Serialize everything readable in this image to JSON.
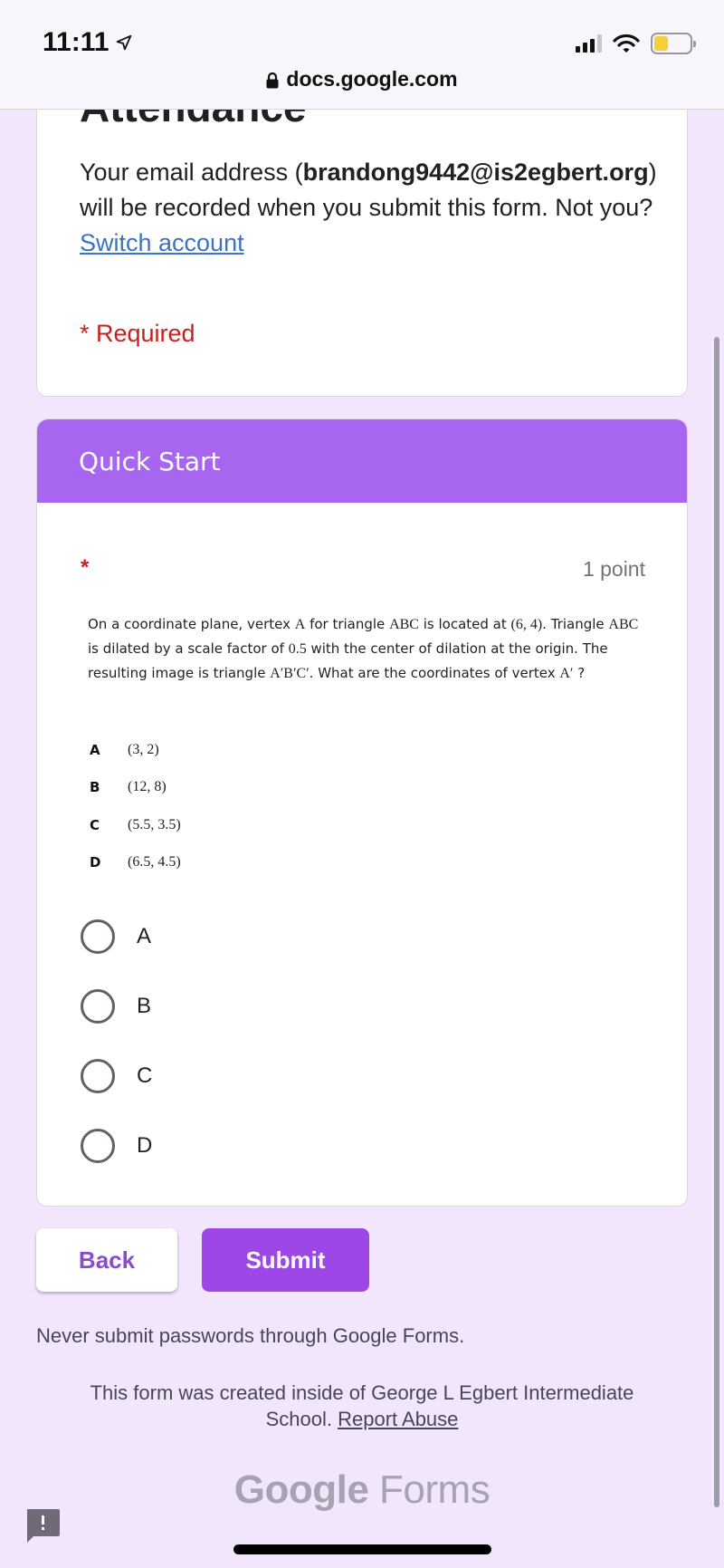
{
  "status_bar": {
    "time": "11:11",
    "location_icon": "location-arrow-icon",
    "signal_icon": "cellular-signal-icon",
    "wifi_icon": "wifi-icon",
    "battery_icon": "battery-icon",
    "battery_level": 0.4
  },
  "browser": {
    "url": "docs.google.com",
    "lock_icon": "lock-icon"
  },
  "form": {
    "title": "Attendance",
    "email_notice": {
      "prefix": "Your email address (",
      "email": "brandong9442@is2egbert.org",
      "suffix": ") will be recorded when you submit this form. Not you? ",
      "switch_link": "Switch account"
    },
    "required_note": "* Required"
  },
  "section": {
    "title": "Quick Start",
    "question": {
      "required_marker": "*",
      "points": "1 point",
      "text_parts": [
        {
          "t": "On a coordinate plane, vertex ",
          "m": false
        },
        {
          "t": "A",
          "m": true
        },
        {
          "t": " for triangle ",
          "m": false
        },
        {
          "t": "ABC",
          "m": true
        },
        {
          "t": " is located at ",
          "m": false
        },
        {
          "t": "(6, 4)",
          "m": true
        },
        {
          "t": ". Triangle ",
          "m": false
        },
        {
          "t": "ABC",
          "m": true
        },
        {
          "t": " is dilated by a scale factor of ",
          "m": false
        },
        {
          "t": "0.5",
          "m": true
        },
        {
          "t": " with the center of dilation at the origin. The resulting image is triangle ",
          "m": false
        },
        {
          "t": "A′B′C′",
          "m": true
        },
        {
          "t": ". What are the coordinates of vertex ",
          "m": false
        },
        {
          "t": "A′",
          "m": true
        },
        {
          "t": " ?",
          "m": false
        }
      ],
      "answer_choices": [
        {
          "letter": "A",
          "value": "(3, 2)"
        },
        {
          "letter": "B",
          "value": "(12, 8)"
        },
        {
          "letter": "C",
          "value": "(5.5, 3.5)"
        },
        {
          "letter": "D",
          "value": "(6.5, 4.5)"
        }
      ],
      "radio_options": [
        {
          "label": "A",
          "selected": false
        },
        {
          "label": "B",
          "selected": false
        },
        {
          "label": "C",
          "selected": false
        },
        {
          "label": "D",
          "selected": false
        }
      ]
    }
  },
  "buttons": {
    "back": "Back",
    "submit": "Submit"
  },
  "footer": {
    "password_warning": "Never submit passwords through Google Forms.",
    "created_note": "This form was created inside of George L Egbert Intermediate School. ",
    "report_abuse": "Report Abuse",
    "brand_google": "Google",
    "brand_forms": " Forms",
    "feedback_icon": "report-feedback-icon"
  },
  "colors": {
    "background": "#f2e6fc",
    "theme_accent": "#a866f0",
    "submit_button": "#9c47e6",
    "required_red": "#c5221f",
    "link_blue": "#3b73c4"
  }
}
